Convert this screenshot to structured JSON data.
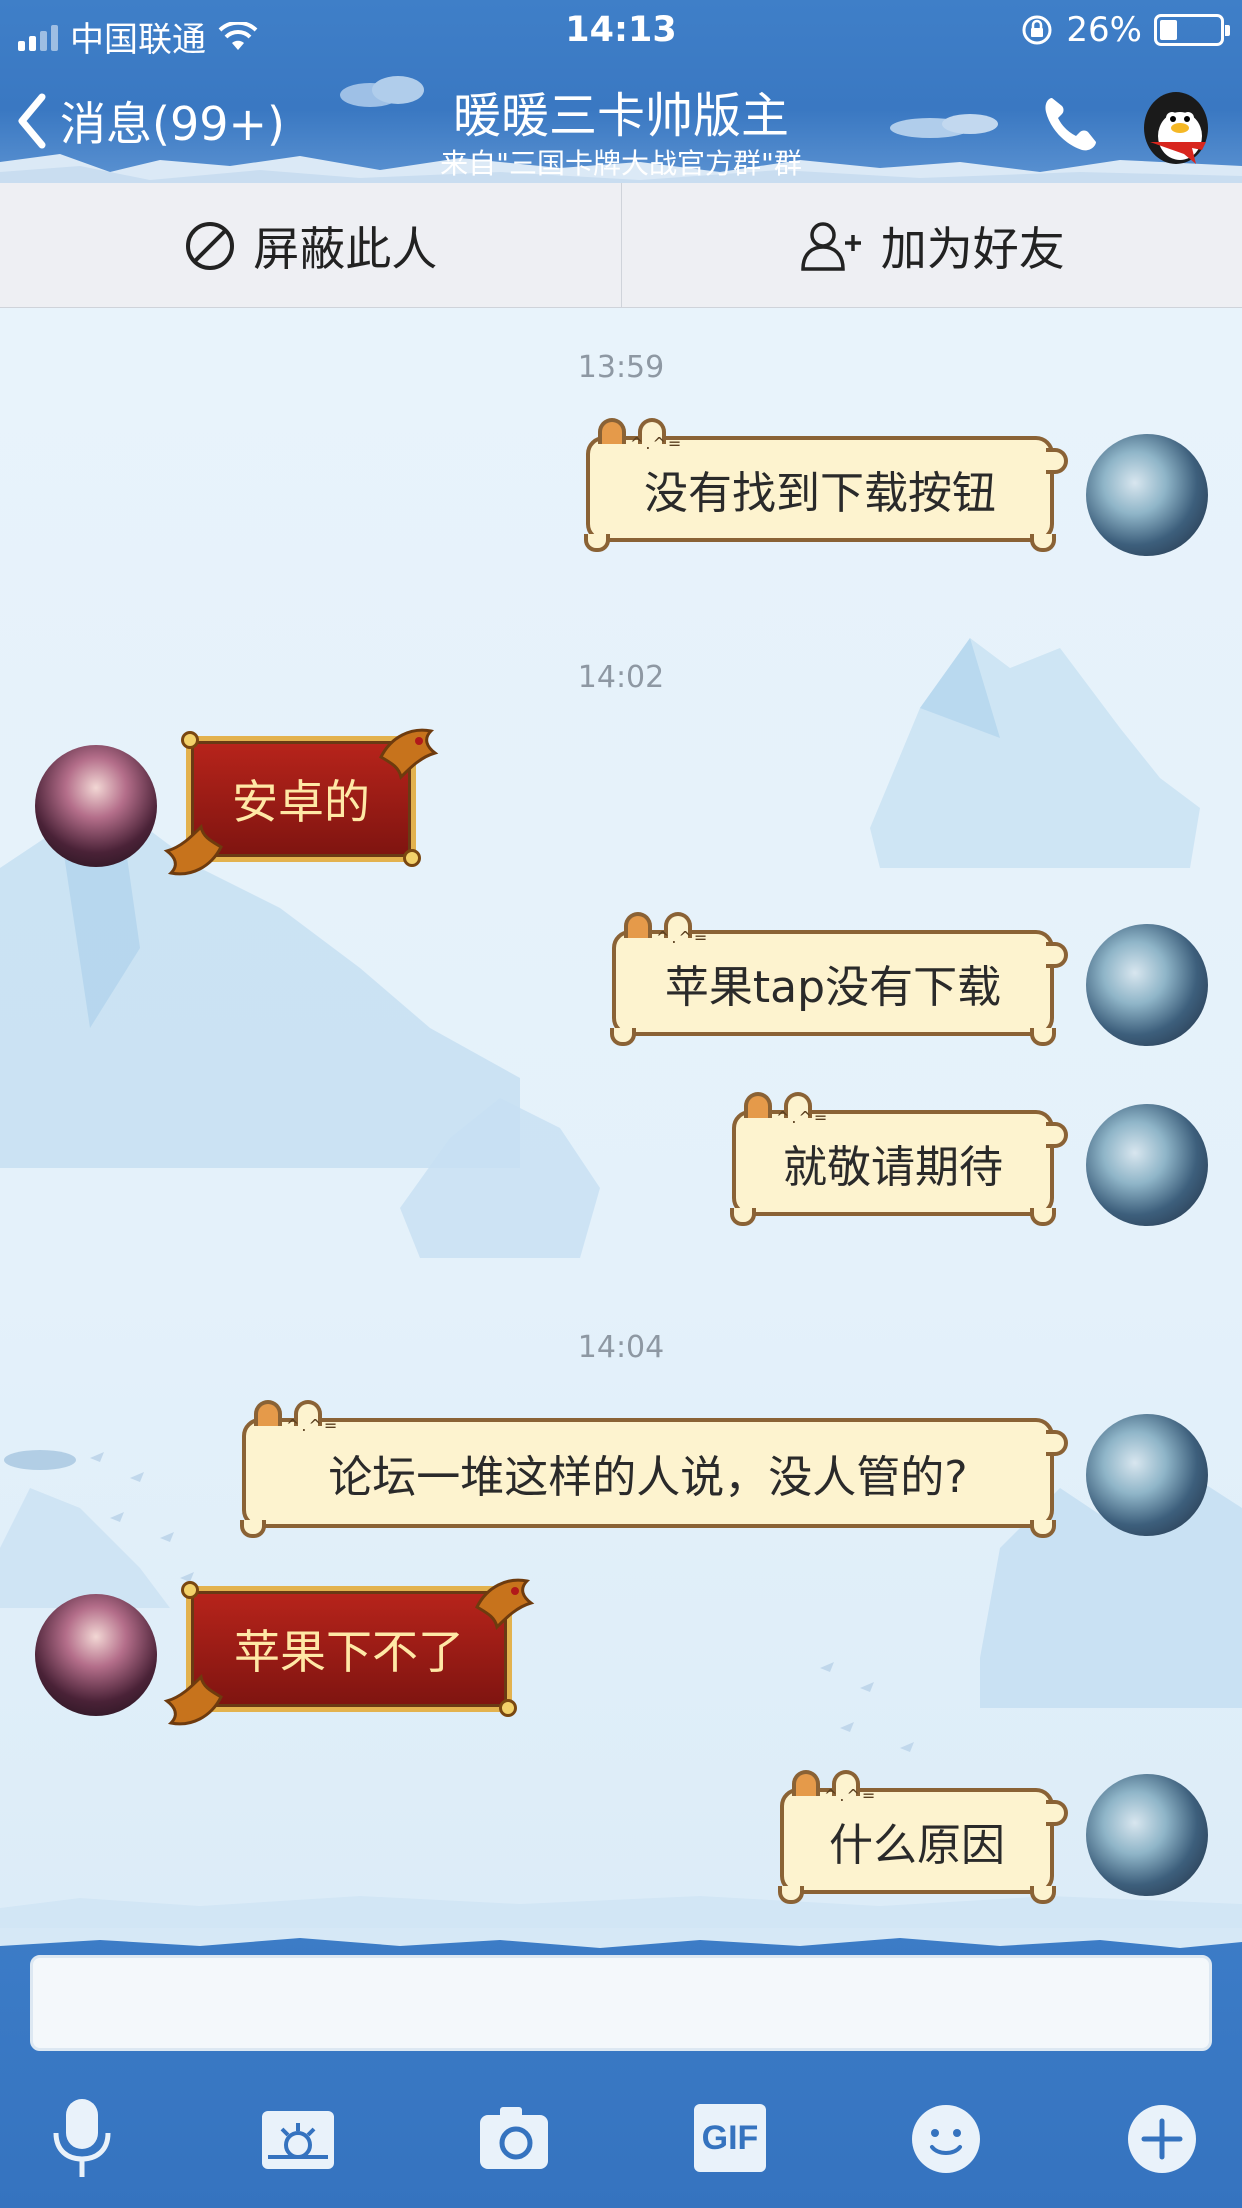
{
  "status": {
    "carrier": "中国联通",
    "time": "14:13",
    "battery": "26%"
  },
  "header": {
    "back_label": "消息(99+)",
    "title": "暖暖三卡帅版主",
    "subtitle": "来自\"三国卡牌大战官方群\"群"
  },
  "actions": {
    "block_label": "屏蔽此人",
    "add_friend_label": "加为好友"
  },
  "timestamps": [
    "13:59",
    "14:02",
    "14:04"
  ],
  "messages": [
    {
      "side": "right",
      "text": "没有找到下载按钮"
    },
    {
      "side": "left",
      "text": "安卓的"
    },
    {
      "side": "right",
      "text": "苹果tap没有下载"
    },
    {
      "side": "right",
      "text": "就敬请期待"
    },
    {
      "side": "right",
      "text": "论坛一堆这样的人说，没人管的?"
    },
    {
      "side": "left",
      "text": "苹果下不了"
    },
    {
      "side": "right",
      "text": "什么原因"
    }
  ],
  "input": {
    "value": "",
    "placeholder": ""
  },
  "toolbar": {
    "gif_label": "GIF",
    "icons": [
      "microphone-icon",
      "photo-icon",
      "camera-icon",
      "gif-icon",
      "emoji-icon",
      "plus-icon"
    ]
  },
  "colors": {
    "header_blue": "#3f7fc8",
    "bubble_cream": "#fdf3cf",
    "bubble_red": "#b8241b"
  }
}
